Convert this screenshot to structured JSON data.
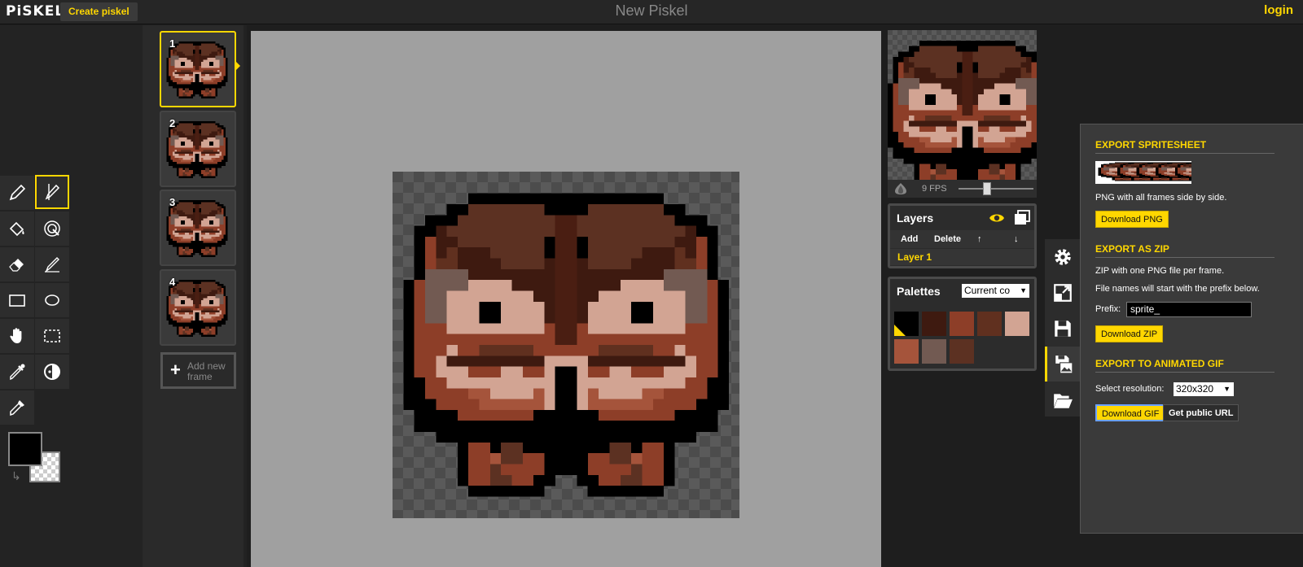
{
  "app": {
    "logo": "PiSKEL",
    "create_button": "Create piskel",
    "title": "New Piskel",
    "login": "login"
  },
  "tools": [
    {
      "name": "pen-tool",
      "icon": "pencil-icon"
    },
    {
      "name": "vertical-mirror-pen-tool",
      "icon": "mirror-pen-icon",
      "selected": true
    },
    {
      "name": "paint-bucket-tool",
      "icon": "bucket-icon"
    },
    {
      "name": "paint-all-same-color-tool",
      "icon": "swirl-bucket-icon"
    },
    {
      "name": "eraser-tool",
      "icon": "eraser-icon"
    },
    {
      "name": "stroke-tool",
      "icon": "line-icon"
    },
    {
      "name": "rectangle-tool",
      "icon": "rectangle-icon"
    },
    {
      "name": "circle-tool",
      "icon": "circle-icon"
    },
    {
      "name": "move-tool",
      "icon": "hand-icon"
    },
    {
      "name": "rectangle-select-tool",
      "icon": "dashed-rect-icon"
    },
    {
      "name": "lighten-tool",
      "icon": "dropper-icon"
    },
    {
      "name": "dithering-tool",
      "icon": "dither-icon"
    },
    {
      "name": "color-picker-tool",
      "icon": "eyedropper-icon"
    }
  ],
  "colors": {
    "primary": "#000000",
    "secondary": "transparent",
    "accent": "#ffd700"
  },
  "frames": {
    "items": [
      {
        "number": "1",
        "selected": true
      },
      {
        "number": "2"
      },
      {
        "number": "3"
      },
      {
        "number": "4"
      }
    ],
    "add_label_line1": "Add new",
    "add_label_line2": "frame"
  },
  "preview": {
    "fps_label": "9 FPS",
    "fps": 9
  },
  "layers": {
    "title": "Layers",
    "buttons": {
      "add": "Add",
      "delete": "Delete",
      "up": "↑",
      "down": "↓"
    },
    "items": [
      "Layer 1"
    ]
  },
  "palettes": {
    "title": "Palettes",
    "selected": "Current co",
    "swatches": [
      "#000000",
      "#3e1a10",
      "#8d3e28",
      "#60301f",
      "#d2a493",
      "#a5543b",
      "#725a52",
      "#5c3122"
    ]
  },
  "export": {
    "spritesheet_heading": "EXPORT SPRITESHEET",
    "spritesheet_desc": "PNG with all frames side by side.",
    "download_png": "Download PNG",
    "zip_heading": "EXPORT AS ZIP",
    "zip_desc1": "ZIP with one PNG file per frame.",
    "zip_desc2": "File names will start with the prefix below.",
    "prefix_label": "Prefix:",
    "prefix_value": "sprite_",
    "download_zip": "Download ZIP",
    "gif_heading": "EXPORT TO ANIMATED GIF",
    "resolution_label": "Select resolution:",
    "resolution_value": "320x320",
    "download_gif": "Download GIF",
    "public_url": "Get public URL"
  },
  "side_tabs": [
    "settings-icon",
    "resize-icon",
    "save-icon",
    "export-icon",
    "open-icon"
  ]
}
